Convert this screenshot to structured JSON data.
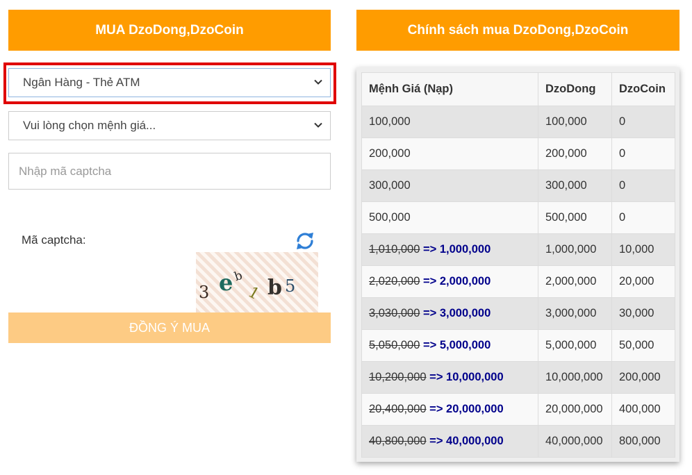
{
  "buy_form": {
    "title": "MUA DzoDong,DzoCoin",
    "payment_method": "Ngân Hàng - Thẻ ATM",
    "amount_placeholder": "Vui lòng chọn mệnh giá...",
    "captcha_placeholder": "Nhập mã captcha",
    "captcha_label": "Mã captcha:",
    "captcha_text": "3eb1b5",
    "agree_label": "ĐỒNG Ý MUA"
  },
  "policy": {
    "title": "Chính sách mua DzoDong,DzoCoin",
    "columns": [
      "Mệnh Giá (Nạp)",
      "DzoDong",
      "DzoCoin"
    ],
    "rows": [
      {
        "old": "",
        "arrow": "",
        "value": "100,000",
        "dzodong": "100,000",
        "dzocoin": "0"
      },
      {
        "old": "",
        "arrow": "",
        "value": "200,000",
        "dzodong": "200,000",
        "dzocoin": "0"
      },
      {
        "old": "",
        "arrow": "",
        "value": "300,000",
        "dzodong": "300,000",
        "dzocoin": "0"
      },
      {
        "old": "",
        "arrow": "",
        "value": "500,000",
        "dzodong": "500,000",
        "dzocoin": "0"
      },
      {
        "old": "1,010,000",
        "arrow": " => ",
        "value": "1,000,000",
        "dzodong": "1,000,000",
        "dzocoin": "10,000"
      },
      {
        "old": "2,020,000",
        "arrow": " => ",
        "value": "2,000,000",
        "dzodong": "2,000,000",
        "dzocoin": "20,000"
      },
      {
        "old": "3,030,000",
        "arrow": " => ",
        "value": "3,000,000",
        "dzodong": "3,000,000",
        "dzocoin": "30,000"
      },
      {
        "old": "5,050,000",
        "arrow": " => ",
        "value": "5,000,000",
        "dzodong": "5,000,000",
        "dzocoin": "50,000"
      },
      {
        "old": "10,200,000",
        "arrow": " => ",
        "value": "10,000,000",
        "dzodong": "10,000,000",
        "dzocoin": "200,000"
      },
      {
        "old": "20,400,000",
        "arrow": " => ",
        "value": "20,000,000",
        "dzodong": "20,000,000",
        "dzocoin": "400,000"
      },
      {
        "old": "40,800,000",
        "arrow": " => ",
        "value": "40,000,000",
        "dzodong": "40,000,000",
        "dzocoin": "800,000"
      }
    ]
  },
  "icons": {
    "select_chevron": "chevron-down-icon",
    "captcha_refresh": "refresh-icon"
  },
  "colors": {
    "header_orange": "#ff9c00",
    "button_disabled": "#fdcb84",
    "highlight_red": "#e00000",
    "new_price_navy": "#00008b",
    "refresh_blue": "#2f7fd6"
  }
}
